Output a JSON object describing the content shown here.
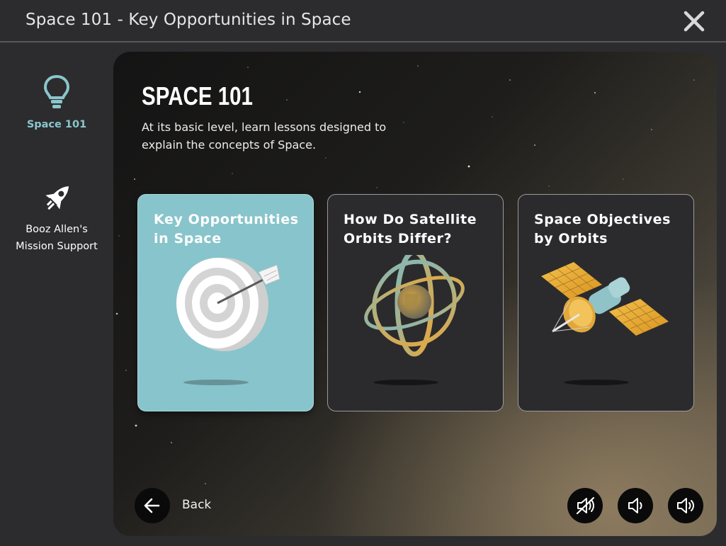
{
  "window": {
    "title": "Space 101 - Key Opportunities in Space",
    "close_icon": "close-icon"
  },
  "sidebar": {
    "items": [
      {
        "label": "Space 101",
        "icon": "lightbulb-icon",
        "active": true
      },
      {
        "label": "Booz Allen's",
        "label2": "Mission Support",
        "icon": "rocket-icon",
        "active": false
      }
    ]
  },
  "main": {
    "heading": "SPACE 101",
    "description": "At its basic level, learn lessons designed to explain the concepts of Space.",
    "cards": [
      {
        "title": "Key Opportunities in Space",
        "icon": "target-icon",
        "selected": true
      },
      {
        "title": "How Do Satellite Orbits Differ?",
        "icon": "orbit-icon",
        "selected": false
      },
      {
        "title": "Space Objectives by Orbits",
        "icon": "satellite-icon",
        "selected": false
      }
    ]
  },
  "footer": {
    "back_label": "Back",
    "back_icon": "arrow-left-icon",
    "buttons": [
      {
        "icon": "sound-off-icon"
      },
      {
        "icon": "volume-low-icon"
      },
      {
        "icon": "volume-high-icon"
      }
    ]
  },
  "colors": {
    "accent": "#88c4cb",
    "background": "#2c2c2e",
    "card_dark": "#2b2b2d",
    "orbit_gold": "#e8a83a"
  }
}
